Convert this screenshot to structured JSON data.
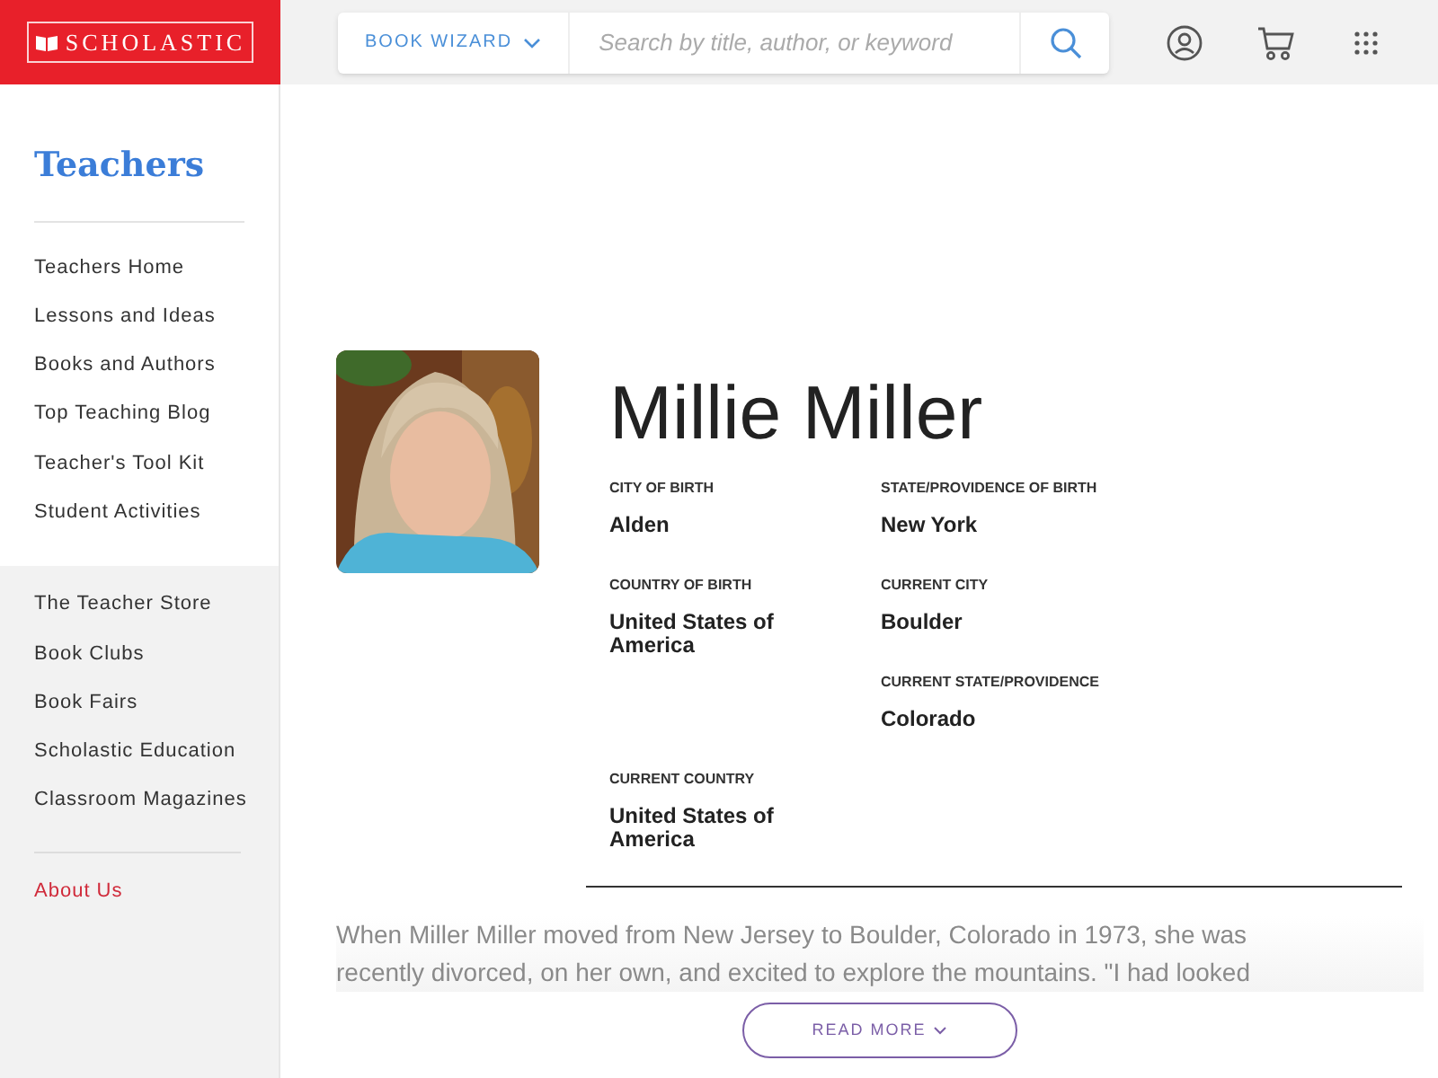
{
  "header": {
    "logo": "SCHOLASTIC",
    "book_wizard": "BOOK WIZARD",
    "search": {
      "placeholder": "Search by title, author, or keyword"
    }
  },
  "sidebar": {
    "title": "Teachers",
    "sections": [
      {
        "shaded": false,
        "items": [
          "Teachers Home",
          "Lessons and Ideas",
          "Books and Authors",
          "Top Teaching Blog",
          "Teacher's Tool Kit",
          "Student Activities"
        ]
      },
      {
        "shaded": true,
        "items": [
          "The Teacher Store",
          "Book Clubs",
          "Book Fairs",
          "Scholastic Education",
          "Classroom Magazines"
        ]
      }
    ],
    "footer_link": "About Us"
  },
  "profile": {
    "name": "Millie Miller",
    "rows": [
      {
        "left": {
          "label": "CITY OF BIRTH",
          "value": "Alden"
        },
        "right": {
          "label": "STATE/PROVIDENCE OF BIRTH",
          "value": "New York"
        }
      },
      {
        "left": {
          "label": "COUNTRY OF BIRTH",
          "value": "United States of America"
        },
        "right": {
          "label": "CURRENT CITY",
          "value": "Boulder"
        }
      },
      {
        "right": {
          "label": "CURRENT STATE/PROVIDENCE",
          "value": "Colorado"
        }
      },
      {
        "left": {
          "label": "CURRENT COUNTRY",
          "value": "United States of America"
        }
      }
    ],
    "bio": "When Miller Miller moved from New Jersey to Boulder, Colorado in 1973, she was recently divorced, on her own, and excited to explore the mountains. \"I had looked",
    "read_more": "READ MORE"
  }
}
